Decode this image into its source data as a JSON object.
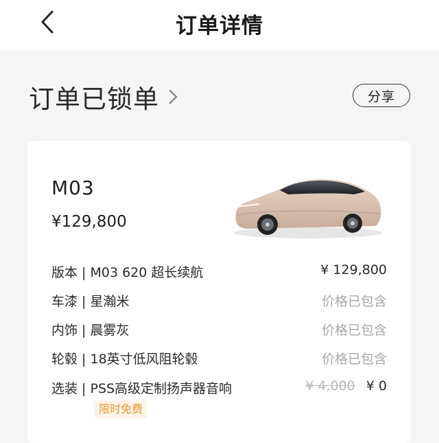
{
  "nav": {
    "title": "订单详情"
  },
  "status": {
    "title": "订单已锁单",
    "share_label": "分享"
  },
  "car": {
    "model": "M03",
    "price": "¥129,800"
  },
  "specs": [
    {
      "label": "版本 | M03 620 超长续航",
      "value": "¥ 129,800"
    },
    {
      "label": "车漆 | 星瀚米",
      "value": "价格已包含"
    },
    {
      "label": "内饰 | 晨雾灰",
      "value": "价格已包含"
    },
    {
      "label": "轮毂 | 18英寸低风阻轮毂",
      "value": "价格已包含"
    },
    {
      "label": "选装 | PSS高级定制扬声器音响",
      "original_price": "¥ 4,000",
      "value": "¥ 0",
      "badge": "限时免费"
    }
  ],
  "colors": {
    "page_bg": "#f5f5f6",
    "badge_text": "#e09a3a",
    "badge_bg": "#fdf3e6",
    "muted": "#a8a8a8"
  }
}
